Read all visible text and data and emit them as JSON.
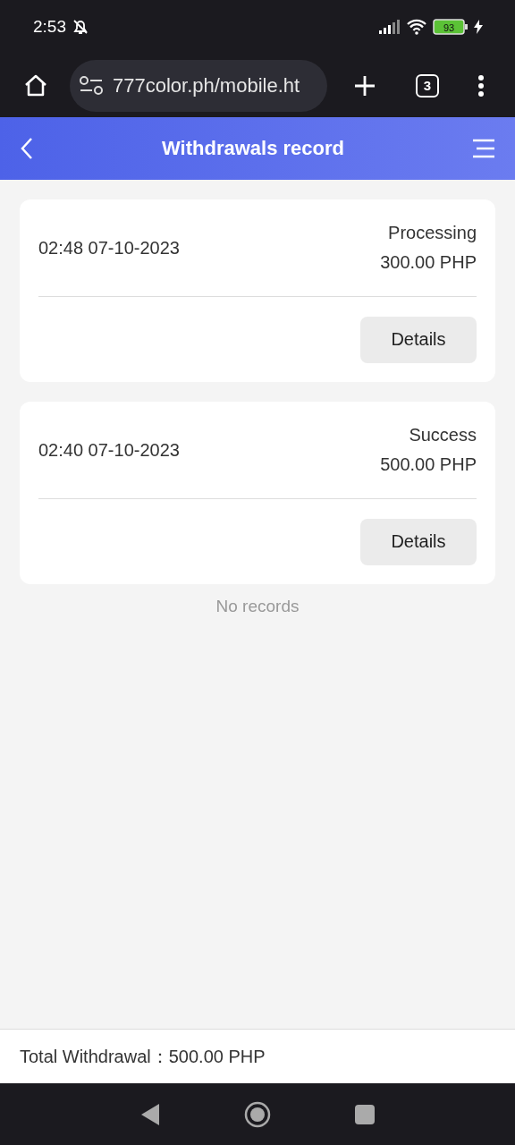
{
  "status_bar": {
    "time": "2:53",
    "battery": "93"
  },
  "browser": {
    "url": "777color.ph/mobile.ht",
    "tab_count": "3"
  },
  "header": {
    "title": "Withdrawals record"
  },
  "records": [
    {
      "datetime": "02:48 07-10-2023",
      "status": "Processing",
      "amount": "300.00 PHP",
      "button": "Details"
    },
    {
      "datetime": "02:40 07-10-2023",
      "status": "Success",
      "amount": "500.00 PHP",
      "button": "Details"
    }
  ],
  "empty_message": "No records",
  "footer": {
    "label": "Total Withdrawal：",
    "value": "500.00 PHP"
  }
}
